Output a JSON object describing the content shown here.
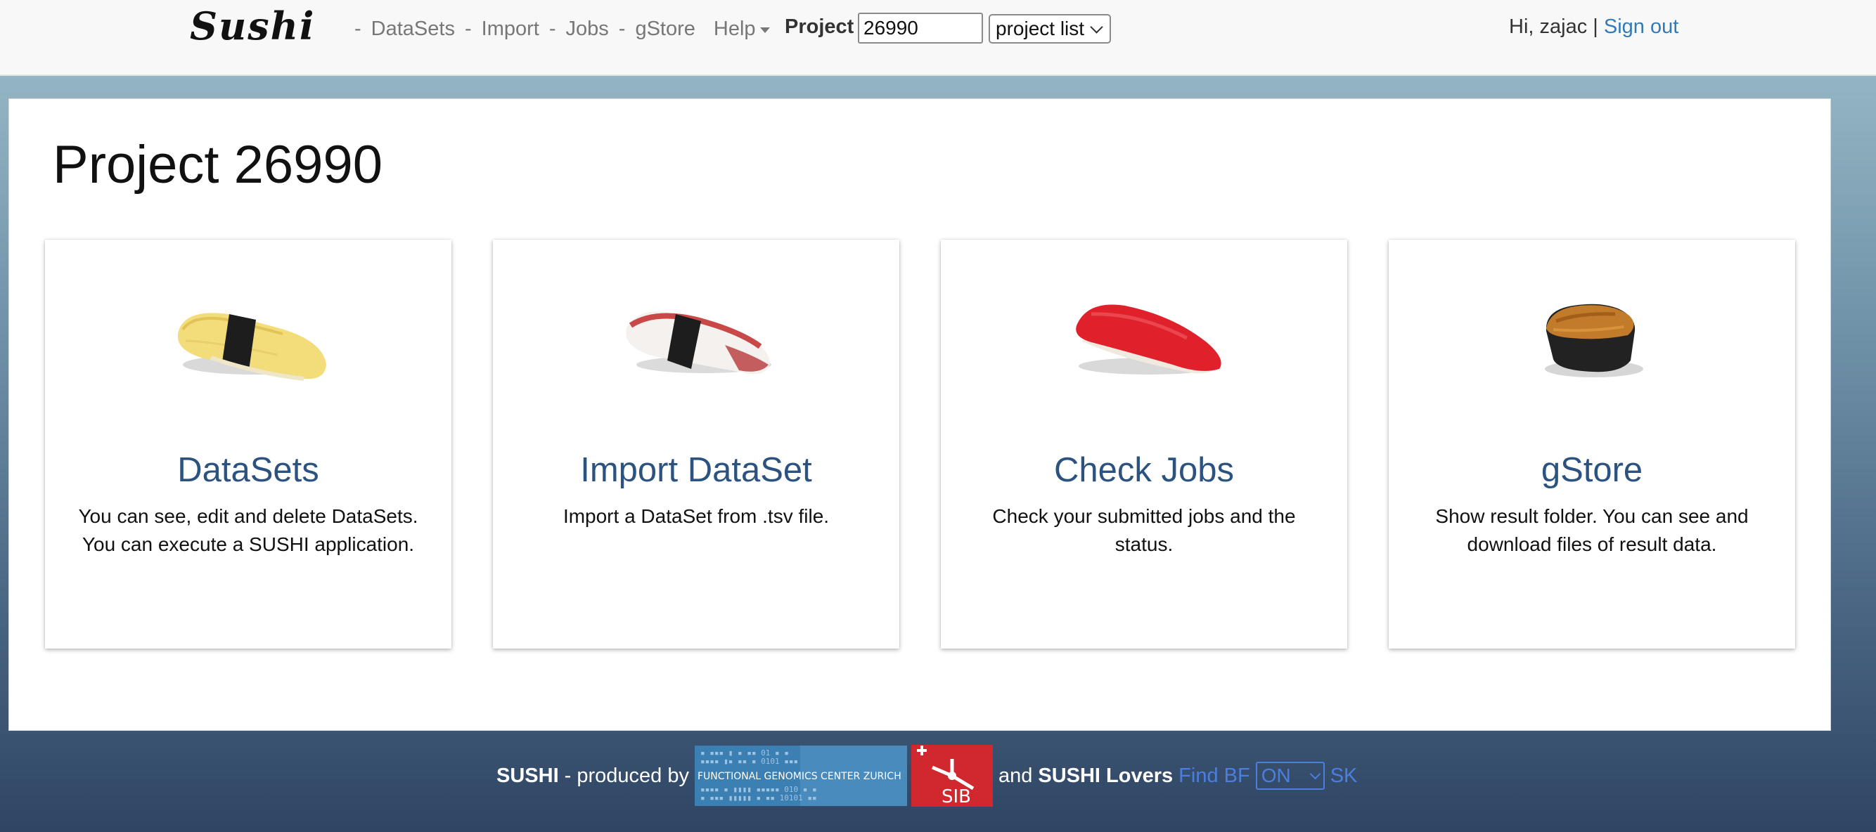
{
  "app": {
    "logo_text": "Sushi"
  },
  "nav": {
    "separator": "-",
    "links": [
      {
        "label": "DataSets"
      },
      {
        "label": "Import"
      },
      {
        "label": "Jobs"
      },
      {
        "label": "gStore"
      }
    ],
    "help_label": "Help",
    "project_label": "Project",
    "project_value": "26990",
    "project_select": "project list",
    "greeting": "Hi, zajac |",
    "signout_label": "Sign out"
  },
  "main": {
    "title": "Project 26990",
    "cards": [
      {
        "title": "DataSets",
        "desc": "You can see, edit and delete DataSets. You can execute a SUSHI application.",
        "image_icon": "tamago-nigiri-icon"
      },
      {
        "title": "Import DataSet",
        "desc": "Import a DataSet from .tsv file.",
        "image_icon": "tako-nigiri-icon"
      },
      {
        "title": "Check Jobs",
        "desc": "Check your submitted jobs and the status.",
        "image_icon": "maguro-nigiri-icon"
      },
      {
        "title": "gStore",
        "desc": "Show result folder. You can see and download files of result data.",
        "image_icon": "uni-gunkan-icon"
      }
    ]
  },
  "footer": {
    "brand": "SUSHI",
    "produced_by": "- produced by",
    "fgcz_logo_text": "FUNCTIONAL GENOMICS CENTER ZURICH",
    "sib_logo_text": "SIB",
    "and_text": "and",
    "lovers": "SUSHI Lovers",
    "find_bf": "Find BF",
    "toggle_value": "ON",
    "sk_label": "SK"
  },
  "colors": {
    "link": "#337ab7",
    "card_title": "#2c5380",
    "footer_link": "#4a7fe0",
    "sib_red": "#d0282e"
  }
}
